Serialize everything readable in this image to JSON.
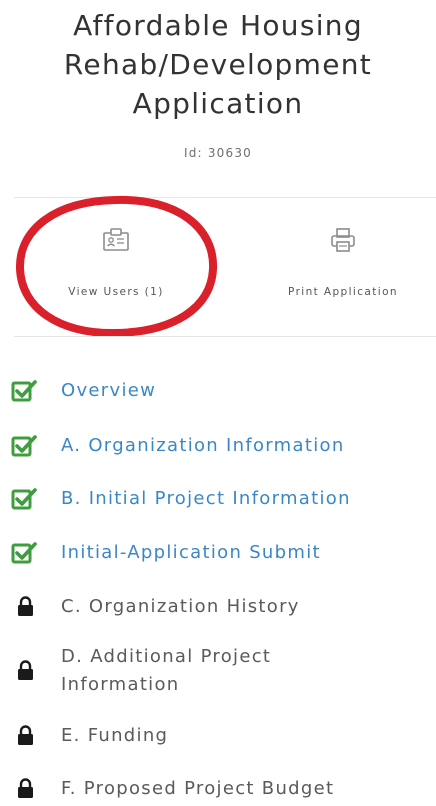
{
  "header": {
    "title_lines": [
      "Affordable Housing",
      "Rehab/Development",
      "Application"
    ],
    "id_text": "Id: 30630"
  },
  "actions": {
    "view_users": {
      "label": "View Users (1)",
      "icon": "users-card-icon"
    },
    "print": {
      "label": "Print Application",
      "icon": "printer-icon"
    }
  },
  "highlight_color": "#d9202b",
  "colors": {
    "complete": "#3f9c3f",
    "link": "#3a87c8",
    "locked_text": "#5a5a5a",
    "lock": "#1a1a1a"
  },
  "sections": [
    {
      "label": "Overview",
      "status": "complete"
    },
    {
      "label": "A. Organization Information",
      "status": "complete"
    },
    {
      "label": "B. Initial Project Information",
      "status": "complete"
    },
    {
      "label": "Initial-Application Submit",
      "status": "complete"
    },
    {
      "label": "C. Organization History",
      "status": "locked"
    },
    {
      "label": "D. Additional Project Information",
      "label_lines": [
        "D. Additional Project",
        "Information"
      ],
      "status": "locked"
    },
    {
      "label": "E. Funding",
      "status": "locked"
    },
    {
      "label": "F. Proposed Project Budget",
      "status": "locked"
    }
  ]
}
